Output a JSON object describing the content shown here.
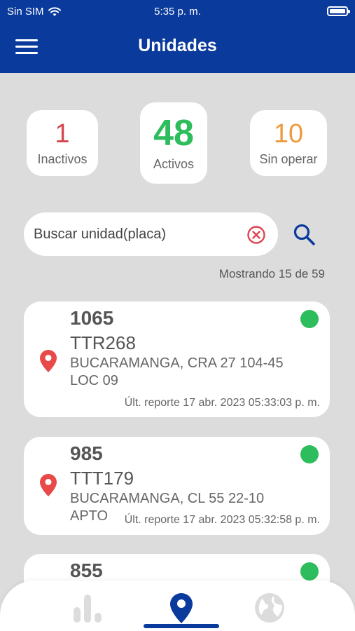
{
  "status_bar": {
    "carrier": "Sin SIM",
    "time": "5:35 p. m."
  },
  "header": {
    "title": "Unidades"
  },
  "stats": {
    "inactive": {
      "value": "1",
      "label": "Inactivos",
      "color": "#d64550"
    },
    "active": {
      "value": "48",
      "label": "Activos",
      "color": "#2ebd5c"
    },
    "no_operation": {
      "value": "10",
      "label": "Sin operar",
      "color": "#f09a3e"
    }
  },
  "search": {
    "placeholder": "Buscar unidad(placa)",
    "value": ""
  },
  "results": {
    "showing": "Mostrando 15 de 59"
  },
  "units": [
    {
      "id": "1065",
      "plate": "TTR268",
      "address": "BUCARAMANGA, CRA 27 104-45 LOC 09",
      "report": "Últ. reporte 17 abr. 2023 05:33:03 p. m.",
      "status_color": "#2ebd5c"
    },
    {
      "id": "985",
      "plate": "TTT179",
      "address": "BUCARAMANGA, CL 55 22-10 APTO",
      "report": "Últ. reporte 17 abr. 2023 05:32:58 p. m.",
      "status_color": "#2ebd5c"
    },
    {
      "id": "855",
      "status_color": "#2ebd5c"
    }
  ],
  "bottom_nav": {
    "items": [
      {
        "icon": "bar-chart-icon",
        "active": false
      },
      {
        "icon": "map-pin-icon",
        "active": true
      },
      {
        "icon": "globe-icon",
        "active": false
      }
    ]
  },
  "colors": {
    "primary": "#0a3a9c",
    "pin": "#e84a4a"
  }
}
